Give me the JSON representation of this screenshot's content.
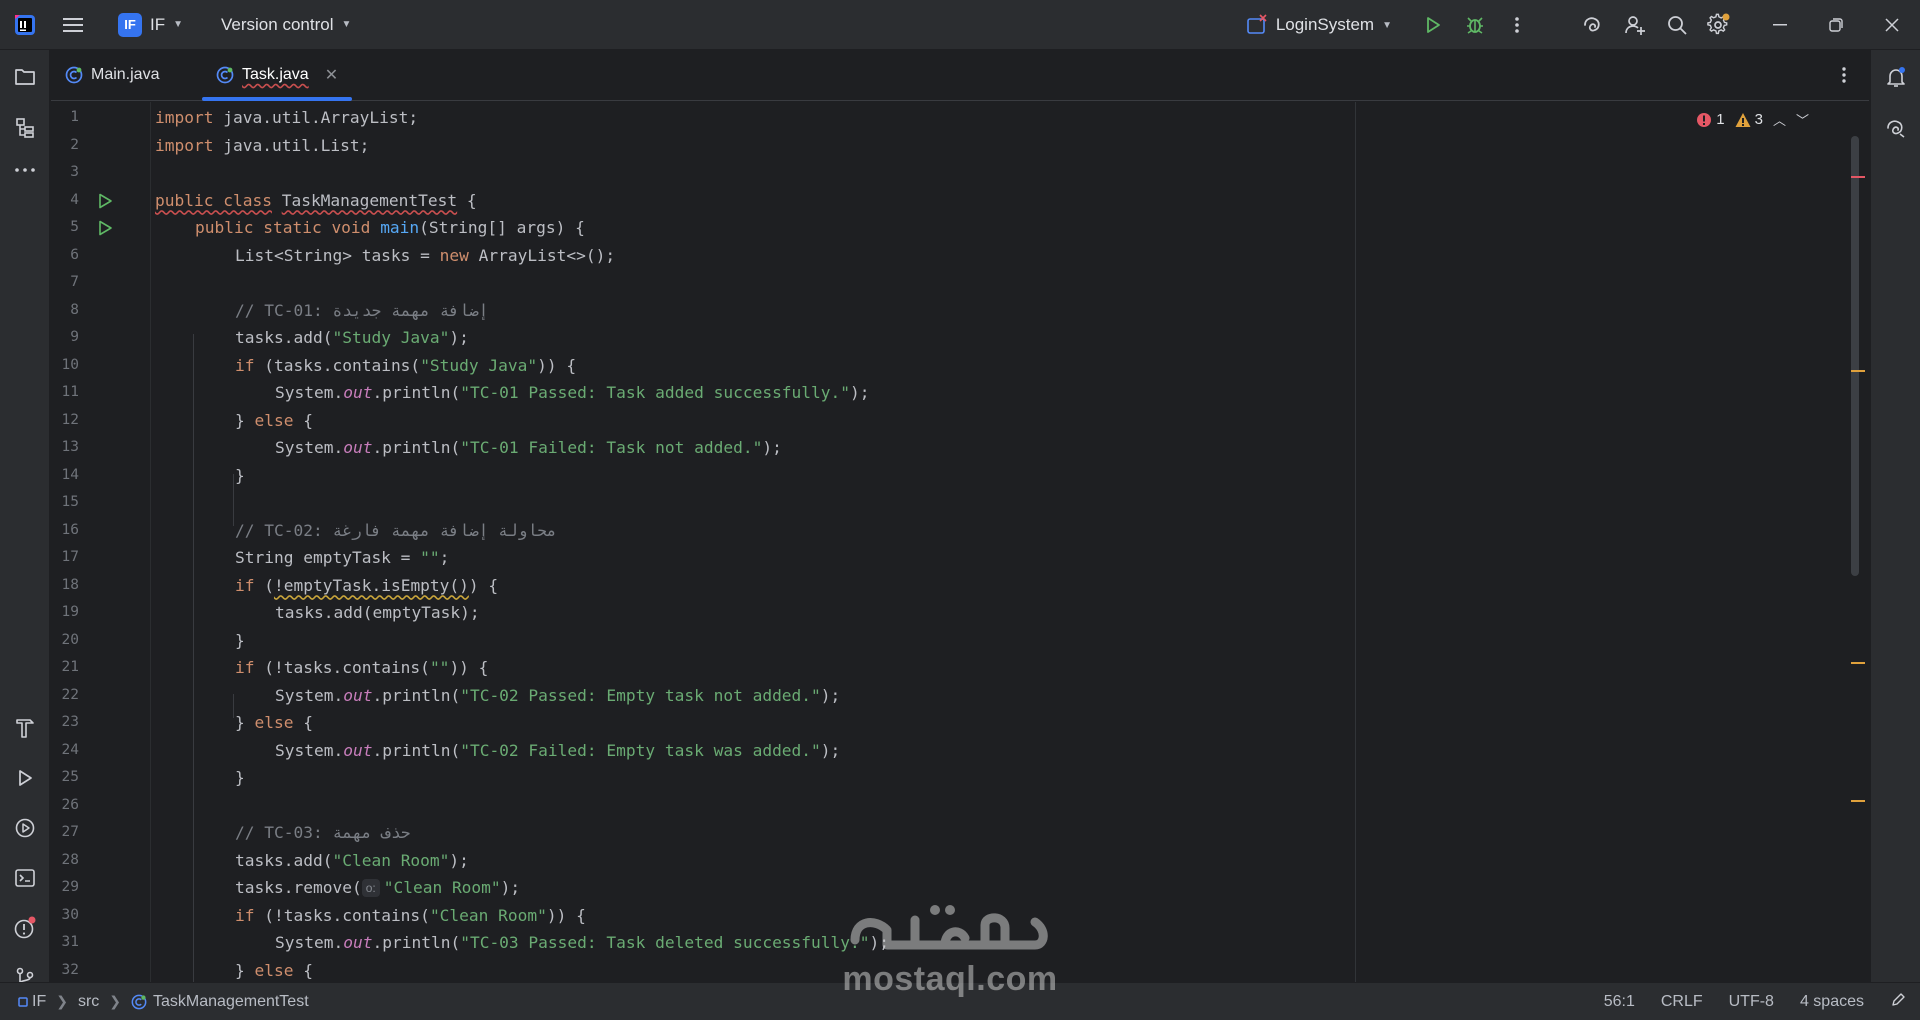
{
  "titlebar": {
    "project_badge": "IF",
    "project_name": "IF",
    "vcs_label": "Version control",
    "run_config": "LoginSystem"
  },
  "tabs": [
    {
      "label": "Main.java",
      "active": false
    },
    {
      "label": "Task.java",
      "active": true
    }
  ],
  "inspections": {
    "errors": "1",
    "warnings": "3"
  },
  "editor": {
    "line_numbers": [
      "1",
      "2",
      "3",
      "4",
      "5",
      "6",
      "7",
      "8",
      "9",
      "10",
      "11",
      "12",
      "13",
      "14",
      "15",
      "16",
      "17",
      "18",
      "19",
      "20",
      "21",
      "22",
      "23",
      "24",
      "25",
      "26",
      "27",
      "28",
      "29",
      "30",
      "31",
      "32"
    ],
    "code": {
      "l1_kw": "import",
      "l1_rest": " java.util.ArrayList;",
      "l2_kw": "import",
      "l2_rest": " java.util.List;",
      "l4_kw": "public class",
      "l4_cls": "TaskManagementTest",
      "l4_rest": " {",
      "l5_kw": "public static void",
      "l5_fn": "main",
      "l5_rest": "(String[] args) {",
      "l6_a": "List<String> tasks = ",
      "l6_kw": "new",
      "l6_b": " ArrayList<>();",
      "l8_cm": "// TC-01: إضافة مهمة جديدة",
      "l9_a": "tasks.add(",
      "l9_str": "\"Study Java\"",
      "l9_b": ");",
      "l10_kw": "if",
      "l10_a": " (tasks.contains(",
      "l10_str": "\"Study Java\"",
      "l10_b": ")) {",
      "l11_a": "System.",
      "l11_st": "out",
      "l11_b": ".println(",
      "l11_str": "\"TC-01 Passed: Task added successfully.\"",
      "l11_c": ");",
      "l12_a": "} ",
      "l12_kw": "else",
      "l12_b": " {",
      "l13_a": "System.",
      "l13_st": "out",
      "l13_b": ".println(",
      "l13_str": "\"TC-01 Failed: Task not added.\"",
      "l13_c": ");",
      "l14": "}",
      "l16_cm": "// TC-02: محاولة إضافة مهمة فارغة",
      "l17_a": "String emptyTask = ",
      "l17_str": "\"\"",
      "l17_b": ";",
      "l18_kw": "if",
      "l18_a": " (",
      "l18_warn": "!emptyTask.isEmpty()",
      "l18_b": ") {",
      "l19": "tasks.add(emptyTask);",
      "l20": "}",
      "l21_kw": "if",
      "l21_a": " (!tasks.contains(",
      "l21_str": "\"\"",
      "l21_b": ")) {",
      "l22_a": "System.",
      "l22_st": "out",
      "l22_b": ".println(",
      "l22_str": "\"TC-02 Passed: Empty task not added.\"",
      "l22_c": ");",
      "l23_a": "} ",
      "l23_kw": "else",
      "l23_b": " {",
      "l24_a": "System.",
      "l24_st": "out",
      "l24_b": ".println(",
      "l24_str": "\"TC-02 Failed: Empty task was added.\"",
      "l24_c": ");",
      "l25": "}",
      "l27_cm": "// TC-03: حذف مهمة",
      "l28_a": "tasks.add(",
      "l28_str": "\"Clean Room\"",
      "l28_b": ");",
      "l29_a": "tasks.remove(",
      "l29_hint": "o:",
      "l29_str": "\"Clean Room\"",
      "l29_b": ");",
      "l30_kw": "if",
      "l30_a": " (!tasks.contains(",
      "l30_str": "\"Clean Room\"",
      "l30_b": ")) {",
      "l31_a": "System.",
      "l31_st": "out",
      "l31_b": ".println(",
      "l31_str": "\"TC-03 Passed: Task deleted successfully.\"",
      "l31_c": ");",
      "l32_a": "} ",
      "l32_kw": "else",
      "l32_b": " {"
    }
  },
  "statusbar": {
    "breadcrumbs": [
      "IF",
      "src",
      "TaskManagementTest"
    ],
    "position": "56:1",
    "line_ending": "CRLF",
    "encoding": "UTF-8",
    "indent": "4 spaces"
  },
  "watermark": {
    "text": "mostaql.com"
  },
  "colors": {
    "accent": "#3574f0",
    "error": "#e55765",
    "warning": "#e0a13c",
    "run": "#5fb865"
  }
}
